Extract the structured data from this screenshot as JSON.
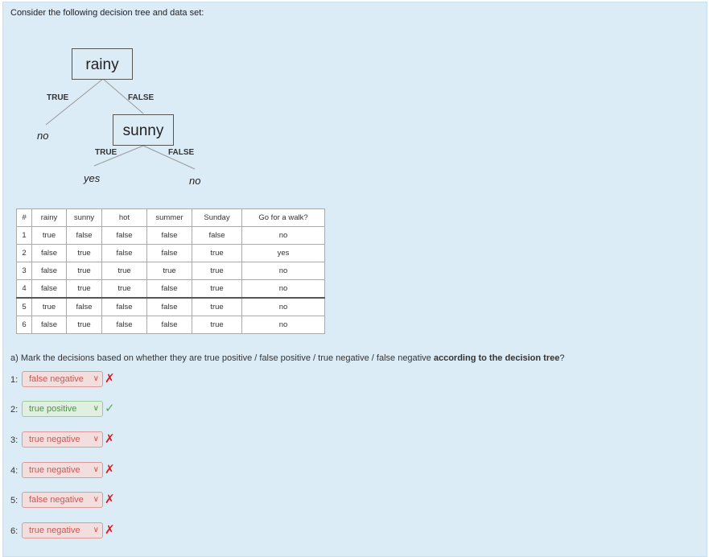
{
  "intro": "Consider the following decision tree and data set:",
  "tree": {
    "root": "rainy",
    "root_true_label": "TRUE",
    "root_false_label": "FALSE",
    "left_leaf": "no",
    "child": "sunny",
    "child_true_label": "TRUE",
    "child_false_label": "FALSE",
    "child_left_leaf": "yes",
    "child_right_leaf": "no"
  },
  "table": {
    "headers": [
      "#",
      "rainy",
      "sunny",
      "hot",
      "summer",
      "Sunday",
      "Go for a walk?"
    ],
    "rows": [
      [
        "1",
        "true",
        "false",
        "false",
        "false",
        "false",
        "no"
      ],
      [
        "2",
        "false",
        "true",
        "false",
        "false",
        "true",
        "yes"
      ],
      [
        "3",
        "false",
        "true",
        "true",
        "true",
        "true",
        "no"
      ],
      [
        "4",
        "false",
        "true",
        "true",
        "false",
        "true",
        "no"
      ],
      [
        "5",
        "true",
        "false",
        "false",
        "false",
        "true",
        "no"
      ],
      [
        "6",
        "false",
        "true",
        "false",
        "false",
        "true",
        "no"
      ]
    ]
  },
  "question": {
    "text": "a) Mark the decisions based on whether they are true positive / false positive / true negative / false negative ",
    "bold": "according to the decision tree",
    "end": "?"
  },
  "answers": [
    {
      "num": "1:",
      "value": "false negative",
      "status": "wrong"
    },
    {
      "num": "2:",
      "value": "true positive",
      "status": "correct"
    },
    {
      "num": "3:",
      "value": "true negative",
      "status": "wrong"
    },
    {
      "num": "4:",
      "value": "true negative",
      "status": "wrong"
    },
    {
      "num": "5:",
      "value": "false negative",
      "status": "wrong"
    },
    {
      "num": "6:",
      "value": "true negative",
      "status": "wrong"
    }
  ],
  "icons": {
    "wrong": "cross-icon",
    "correct": "check-icon",
    "dropdown": "chevron-down-icon"
  },
  "colors": {
    "panel": "#dcecf6",
    "wrong": "#e0181e",
    "correct": "#4fb04f"
  }
}
